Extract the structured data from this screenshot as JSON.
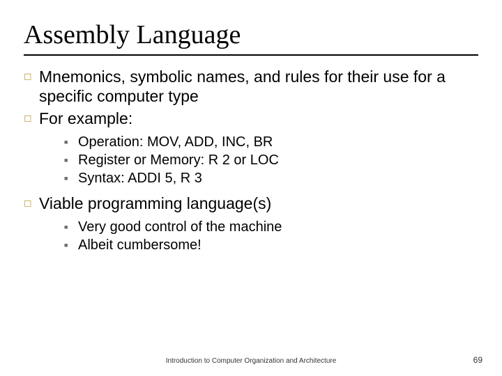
{
  "title": "Assembly Language",
  "bullets": {
    "b0": "Mnemonics, symbolic names, and rules for their use for a specific computer type",
    "b1": "For example:",
    "b1_sub": {
      "s0": "Operation:  MOV, ADD, INC, BR",
      "s1": "Register or Memory: R 2 or LOC",
      "s2": "Syntax:  ADDI 5, R 3"
    },
    "b2": "Viable programming language(s)",
    "b2_sub": {
      "s0": "Very good control of the machine",
      "s1": "Albeit cumbersome!"
    }
  },
  "footer": {
    "center": "Introduction to Computer Organization and Architecture",
    "page": "69"
  }
}
